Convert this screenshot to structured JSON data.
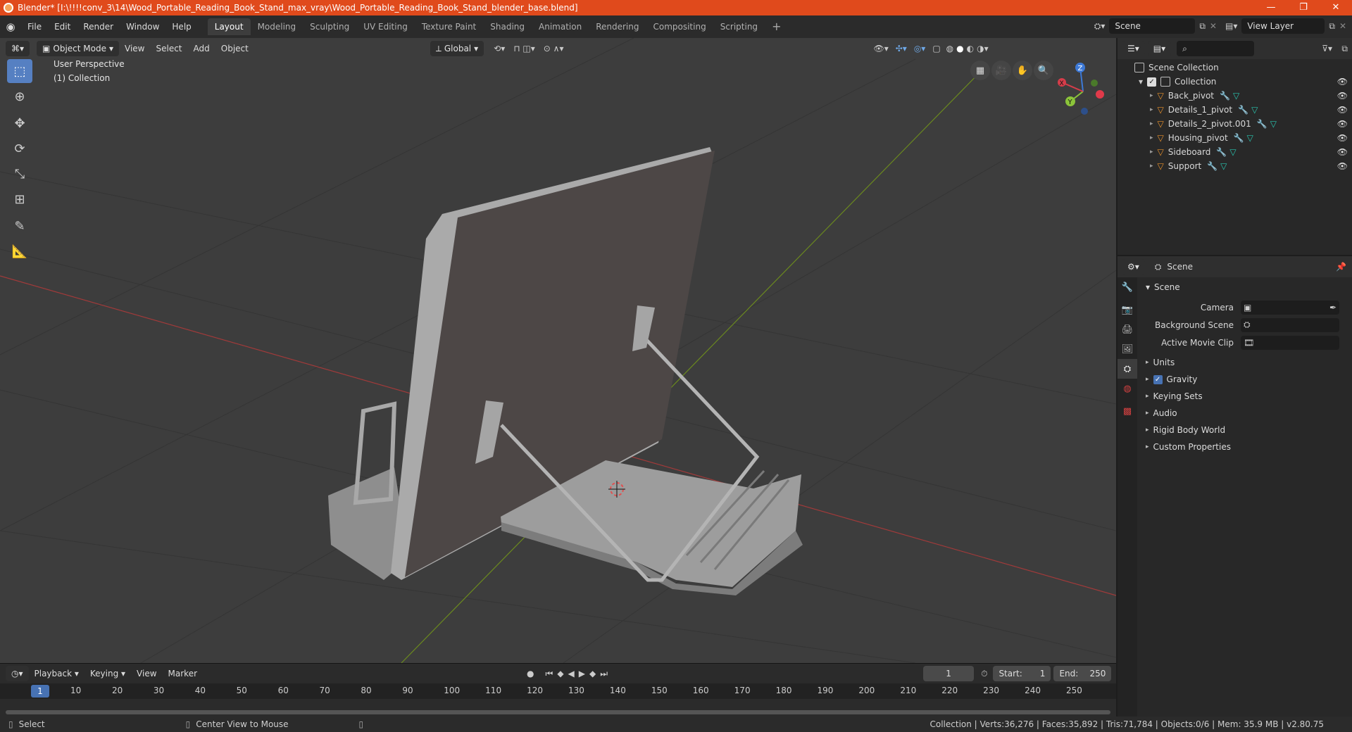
{
  "window": {
    "title": "Blender* [I:\\!!!!conv_3\\14\\Wood_Portable_Reading_Book_Stand_max_vray\\Wood_Portable_Reading_Book_Stand_blender_base.blend]",
    "minimize": "—",
    "maximize": "❐",
    "close": "✕"
  },
  "menu": [
    "File",
    "Edit",
    "Render",
    "Window",
    "Help"
  ],
  "workspaces": [
    "Layout",
    "Modeling",
    "Sculpting",
    "UV Editing",
    "Texture Paint",
    "Shading",
    "Animation",
    "Rendering",
    "Compositing",
    "Scripting"
  ],
  "workspace_add": "+",
  "scene_field": "Scene",
  "view_layer_field": "View Layer",
  "viewport": {
    "mode": "Object Mode",
    "menus": [
      "View",
      "Select",
      "Add",
      "Object"
    ],
    "transform_orientation": "Global",
    "perspective_label": "User Perspective",
    "collection_label": "(1) Collection",
    "gizmo": {
      "x": "X",
      "y": "Y",
      "z": "Z"
    }
  },
  "timeline": {
    "menus": [
      "Playback",
      "Keying",
      "View",
      "Marker"
    ],
    "current_frame": "1",
    "start_label": "Start:",
    "start": "1",
    "end_label": "End:",
    "end": "250",
    "ticks": [
      "1",
      "10",
      "20",
      "30",
      "40",
      "50",
      "60",
      "70",
      "80",
      "90",
      "100",
      "110",
      "120",
      "130",
      "140",
      "150",
      "160",
      "170",
      "180",
      "190",
      "200",
      "210",
      "220",
      "230",
      "240",
      "250"
    ]
  },
  "statusbar": {
    "select": "Select",
    "center_view": "Center View to Mouse",
    "stats": "Collection | Verts:36,276 | Faces:35,892 | Tris:71,784 | Objects:0/6 | Mem: 35.9 MB | v2.80.75"
  },
  "outliner": {
    "root": "Scene Collection",
    "collection": "Collection",
    "items": [
      "Back_pivot",
      "Details_1_pivot",
      "Details_2_pivot.001",
      "Housing_pivot",
      "Sideboard",
      "Support"
    ]
  },
  "properties": {
    "header": "Scene",
    "panel_title": "Scene",
    "fields": [
      {
        "label": "Camera"
      },
      {
        "label": "Background Scene"
      },
      {
        "label": "Active Movie Clip"
      }
    ],
    "sections": [
      "Units",
      "Gravity",
      "Keying Sets",
      "Audio",
      "Rigid Body World",
      "Custom Properties"
    ]
  },
  "colors": {
    "accent": "#4772b3",
    "titlebar": "#e04a1c",
    "object_icon": "#e8912d",
    "modifier_icon": "#6fa9e8",
    "mesh_icon": "#29c6b0"
  }
}
